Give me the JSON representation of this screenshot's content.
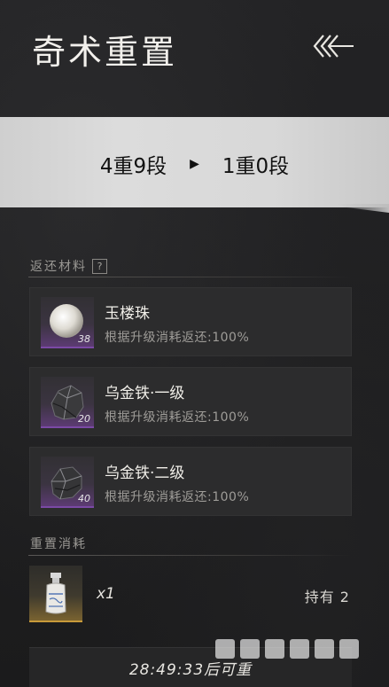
{
  "header": {
    "title": "奇术重置"
  },
  "banner": {
    "from": "4重9段",
    "to": "1重0段"
  },
  "materials_section": {
    "label": "返还材料",
    "help": "?",
    "items": [
      {
        "name": "玉楼珠",
        "desc": "根据升级消耗返还:100%",
        "count": "38",
        "icon": "pearl-icon"
      },
      {
        "name": "乌金铁·一级",
        "desc": "根据升级消耗返还:100%",
        "count": "20",
        "icon": "ore-icon"
      },
      {
        "name": "乌金铁·二级",
        "desc": "根据升级消耗返还:100%",
        "count": "40",
        "icon": "ore-icon"
      }
    ]
  },
  "cost_section": {
    "label": "重置消耗",
    "qty": "x1",
    "held": "持有 2",
    "icon": "potion-bottle-icon"
  },
  "footer": {
    "text": "28:49:33后可重"
  },
  "colors": {
    "background": "#1d1d1e",
    "banner": "#d8d8d8",
    "purple_rarity": "#7b49a5",
    "gold_rarity": "#c89a3a"
  }
}
